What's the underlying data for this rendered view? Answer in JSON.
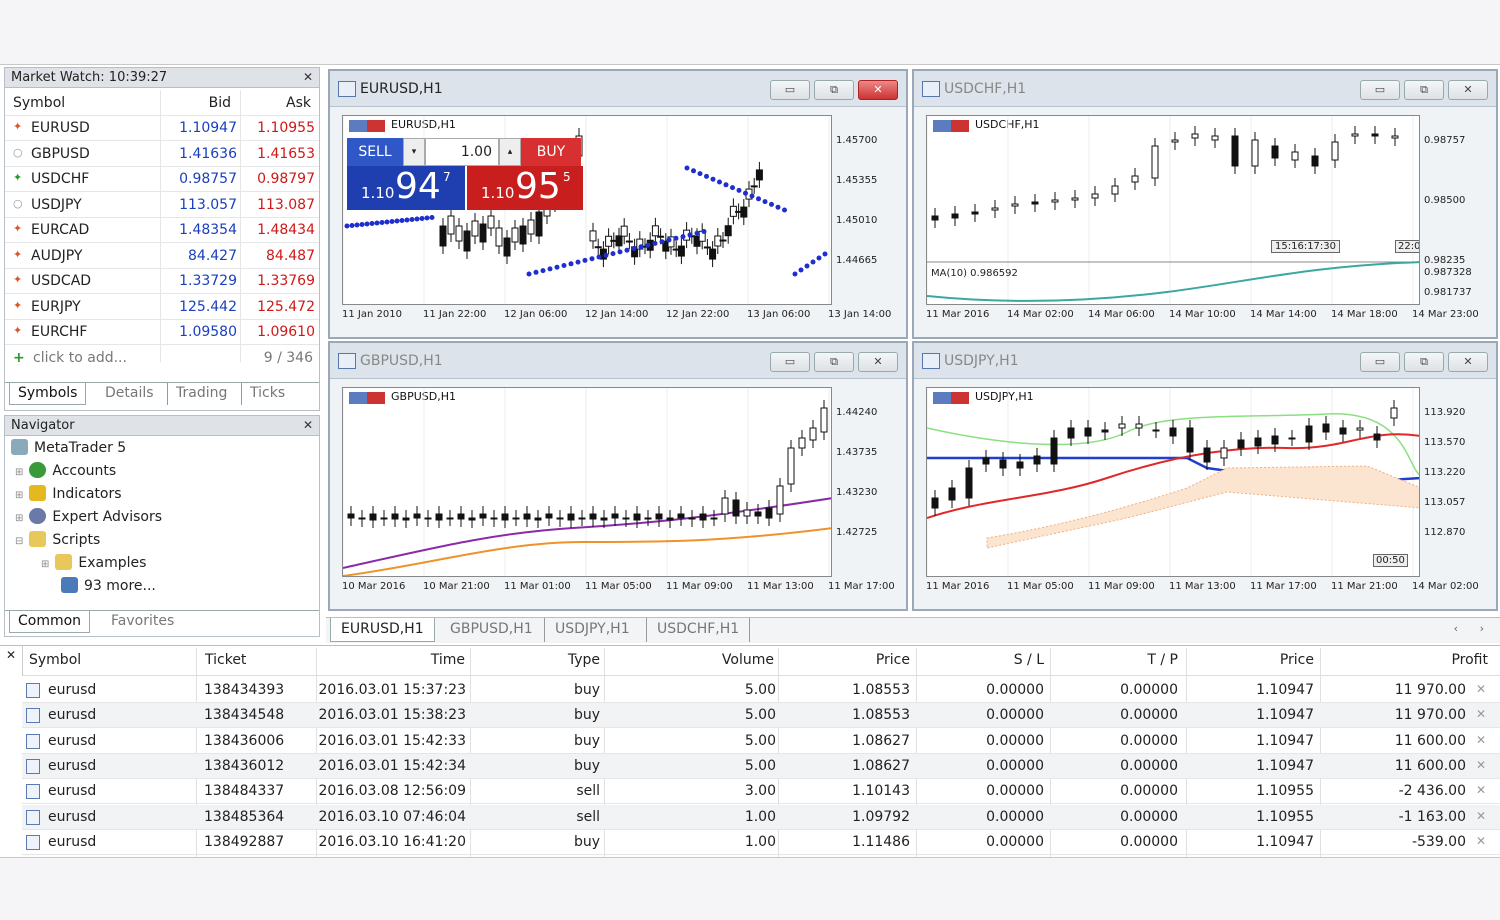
{
  "market_watch": {
    "title": "Market Watch: 10:39:27",
    "cols": [
      "Symbol",
      "Bid",
      "Ask"
    ],
    "rows": [
      {
        "sym": "EURUSD",
        "bid": "1.10947",
        "ask": "1.10955",
        "dir": "up"
      },
      {
        "sym": "GBPUSD",
        "bid": "1.41636",
        "ask": "1.41653",
        "dir": "flat"
      },
      {
        "sym": "USDCHF",
        "bid": "0.98757",
        "ask": "0.98797",
        "dir": "down"
      },
      {
        "sym": "USDJPY",
        "bid": "113.057",
        "ask": "113.087",
        "dir": "flat"
      },
      {
        "sym": "EURCAD",
        "bid": "1.48354",
        "ask": "1.48434",
        "dir": "up"
      },
      {
        "sym": "AUDJPY",
        "bid": "84.427",
        "ask": "84.487",
        "dir": "up"
      },
      {
        "sym": "USDCAD",
        "bid": "1.33729",
        "ask": "1.33769",
        "dir": "up"
      },
      {
        "sym": "EURJPY",
        "bid": "125.442",
        "ask": "125.472",
        "dir": "up"
      },
      {
        "sym": "EURCHF",
        "bid": "1.09580",
        "ask": "1.09610",
        "dir": "up"
      }
    ],
    "add_label": "click to add...",
    "count": "9 / 346",
    "tabs": [
      "Symbols",
      "Details",
      "Trading",
      "Ticks"
    ]
  },
  "navigator": {
    "title": "Navigator",
    "root": "MetaTrader 5",
    "items": [
      "Accounts",
      "Indicators",
      "Expert Advisors",
      "Scripts",
      "Examples",
      "93 more..."
    ],
    "tabs": [
      "Common",
      "Favorites"
    ]
  },
  "charts": [
    {
      "window": "EURUSD,H1",
      "label": "EURUSD,H1",
      "prices": [
        "1.45700",
        "1.45355",
        "1.45010",
        "1.44665"
      ],
      "times": [
        "11 Jan 2010",
        "11 Jan 22:00",
        "12 Jan 06:00",
        "12 Jan 14:00",
        "12 Jan 22:00",
        "13 Jan 06:00",
        "13 Jan 14:00"
      ],
      "trade": {
        "sell": "SELL",
        "buy": "BUY",
        "volume": "1.00",
        "sell_small": "1.10",
        "sell_big": "94",
        "sell_sup": "7",
        "buy_small": "1.10",
        "buy_big": "95",
        "buy_sup": "5"
      }
    },
    {
      "window": "USDCHF,H1",
      "label": "USDCHF,H1",
      "prices": [
        "0.98757",
        "0.98500",
        "0.98235"
      ],
      "indicator": "MA(10) 0.986592",
      "ind_prices": [
        "0.987328",
        "0.981737"
      ],
      "times": [
        "11 Mar 2016",
        "14 Mar 02:00",
        "14 Mar 06:00",
        "14 Mar 10:00",
        "14 Mar 14:00",
        "14 Mar 18:00",
        "14 Mar 23:00"
      ],
      "marker": "15:16:17:30",
      "marker2": "22:0"
    },
    {
      "window": "GBPUSD,H1",
      "label": "GBPUSD,H1",
      "prices": [
        "1.44240",
        "1.43735",
        "1.43230",
        "1.42725"
      ],
      "times": [
        "10 Mar 2016",
        "10 Mar 21:00",
        "11 Mar 01:00",
        "11 Mar 05:00",
        "11 Mar 09:00",
        "11 Mar 13:00",
        "11 Mar 17:00"
      ]
    },
    {
      "window": "USDJPY,H1",
      "label": "USDJPY,H1",
      "prices": [
        "113.920",
        "113.570",
        "113.220",
        "113.057",
        "112.870"
      ],
      "times": [
        "11 Mar 2016",
        "11 Mar 05:00",
        "11 Mar 09:00",
        "11 Mar 13:00",
        "11 Mar 17:00",
        "11 Mar 21:00",
        "14 Mar 02:00"
      ],
      "marker": "00:50"
    }
  ],
  "chart_tabs": [
    "EURUSD,H1",
    "GBPUSD,H1",
    "USDJPY,H1",
    "USDCHF,H1"
  ],
  "trade_table": {
    "headers": [
      "Symbol",
      "Ticket",
      "Time",
      "Type",
      "Volume",
      "Price",
      "S / L",
      "T / P",
      "Price",
      "Profit"
    ],
    "rows": [
      {
        "symbol": "eurusd",
        "ticket": "138434393",
        "time": "2016.03.01 15:37:23",
        "type": "buy",
        "volume": "5.00",
        "price": "1.08553",
        "sl": "0.00000",
        "tp": "0.00000",
        "cur": "1.10947",
        "profit": "11 970.00"
      },
      {
        "symbol": "eurusd",
        "ticket": "138434548",
        "time": "2016.03.01 15:38:23",
        "type": "buy",
        "volume": "5.00",
        "price": "1.08553",
        "sl": "0.00000",
        "tp": "0.00000",
        "cur": "1.10947",
        "profit": "11 970.00"
      },
      {
        "symbol": "eurusd",
        "ticket": "138436006",
        "time": "2016.03.01 15:42:33",
        "type": "buy",
        "volume": "5.00",
        "price": "1.08627",
        "sl": "0.00000",
        "tp": "0.00000",
        "cur": "1.10947",
        "profit": "11 600.00"
      },
      {
        "symbol": "eurusd",
        "ticket": "138436012",
        "time": "2016.03.01 15:42:34",
        "type": "buy",
        "volume": "5.00",
        "price": "1.08627",
        "sl": "0.00000",
        "tp": "0.00000",
        "cur": "1.10947",
        "profit": "11 600.00"
      },
      {
        "symbol": "eurusd",
        "ticket": "138484337",
        "time": "2016.03.08 12:56:09",
        "type": "sell",
        "volume": "3.00",
        "price": "1.10143",
        "sl": "0.00000",
        "tp": "0.00000",
        "cur": "1.10955",
        "profit": "-2 436.00"
      },
      {
        "symbol": "eurusd",
        "ticket": "138485364",
        "time": "2016.03.10 07:46:04",
        "type": "sell",
        "volume": "1.00",
        "price": "1.09792",
        "sl": "0.00000",
        "tp": "0.00000",
        "cur": "1.10955",
        "profit": "-1 163.00"
      },
      {
        "symbol": "eurusd",
        "ticket": "138492887",
        "time": "2016.03.10 16:41:20",
        "type": "buy",
        "volume": "1.00",
        "price": "1.11486",
        "sl": "0.00000",
        "tp": "0.00000",
        "cur": "1.10947",
        "profit": "-539.00"
      }
    ]
  },
  "colors": {
    "bid": "#1a3fbf",
    "ask": "#d01818",
    "sell": "#1f3fb0",
    "buy": "#c81e1e"
  }
}
